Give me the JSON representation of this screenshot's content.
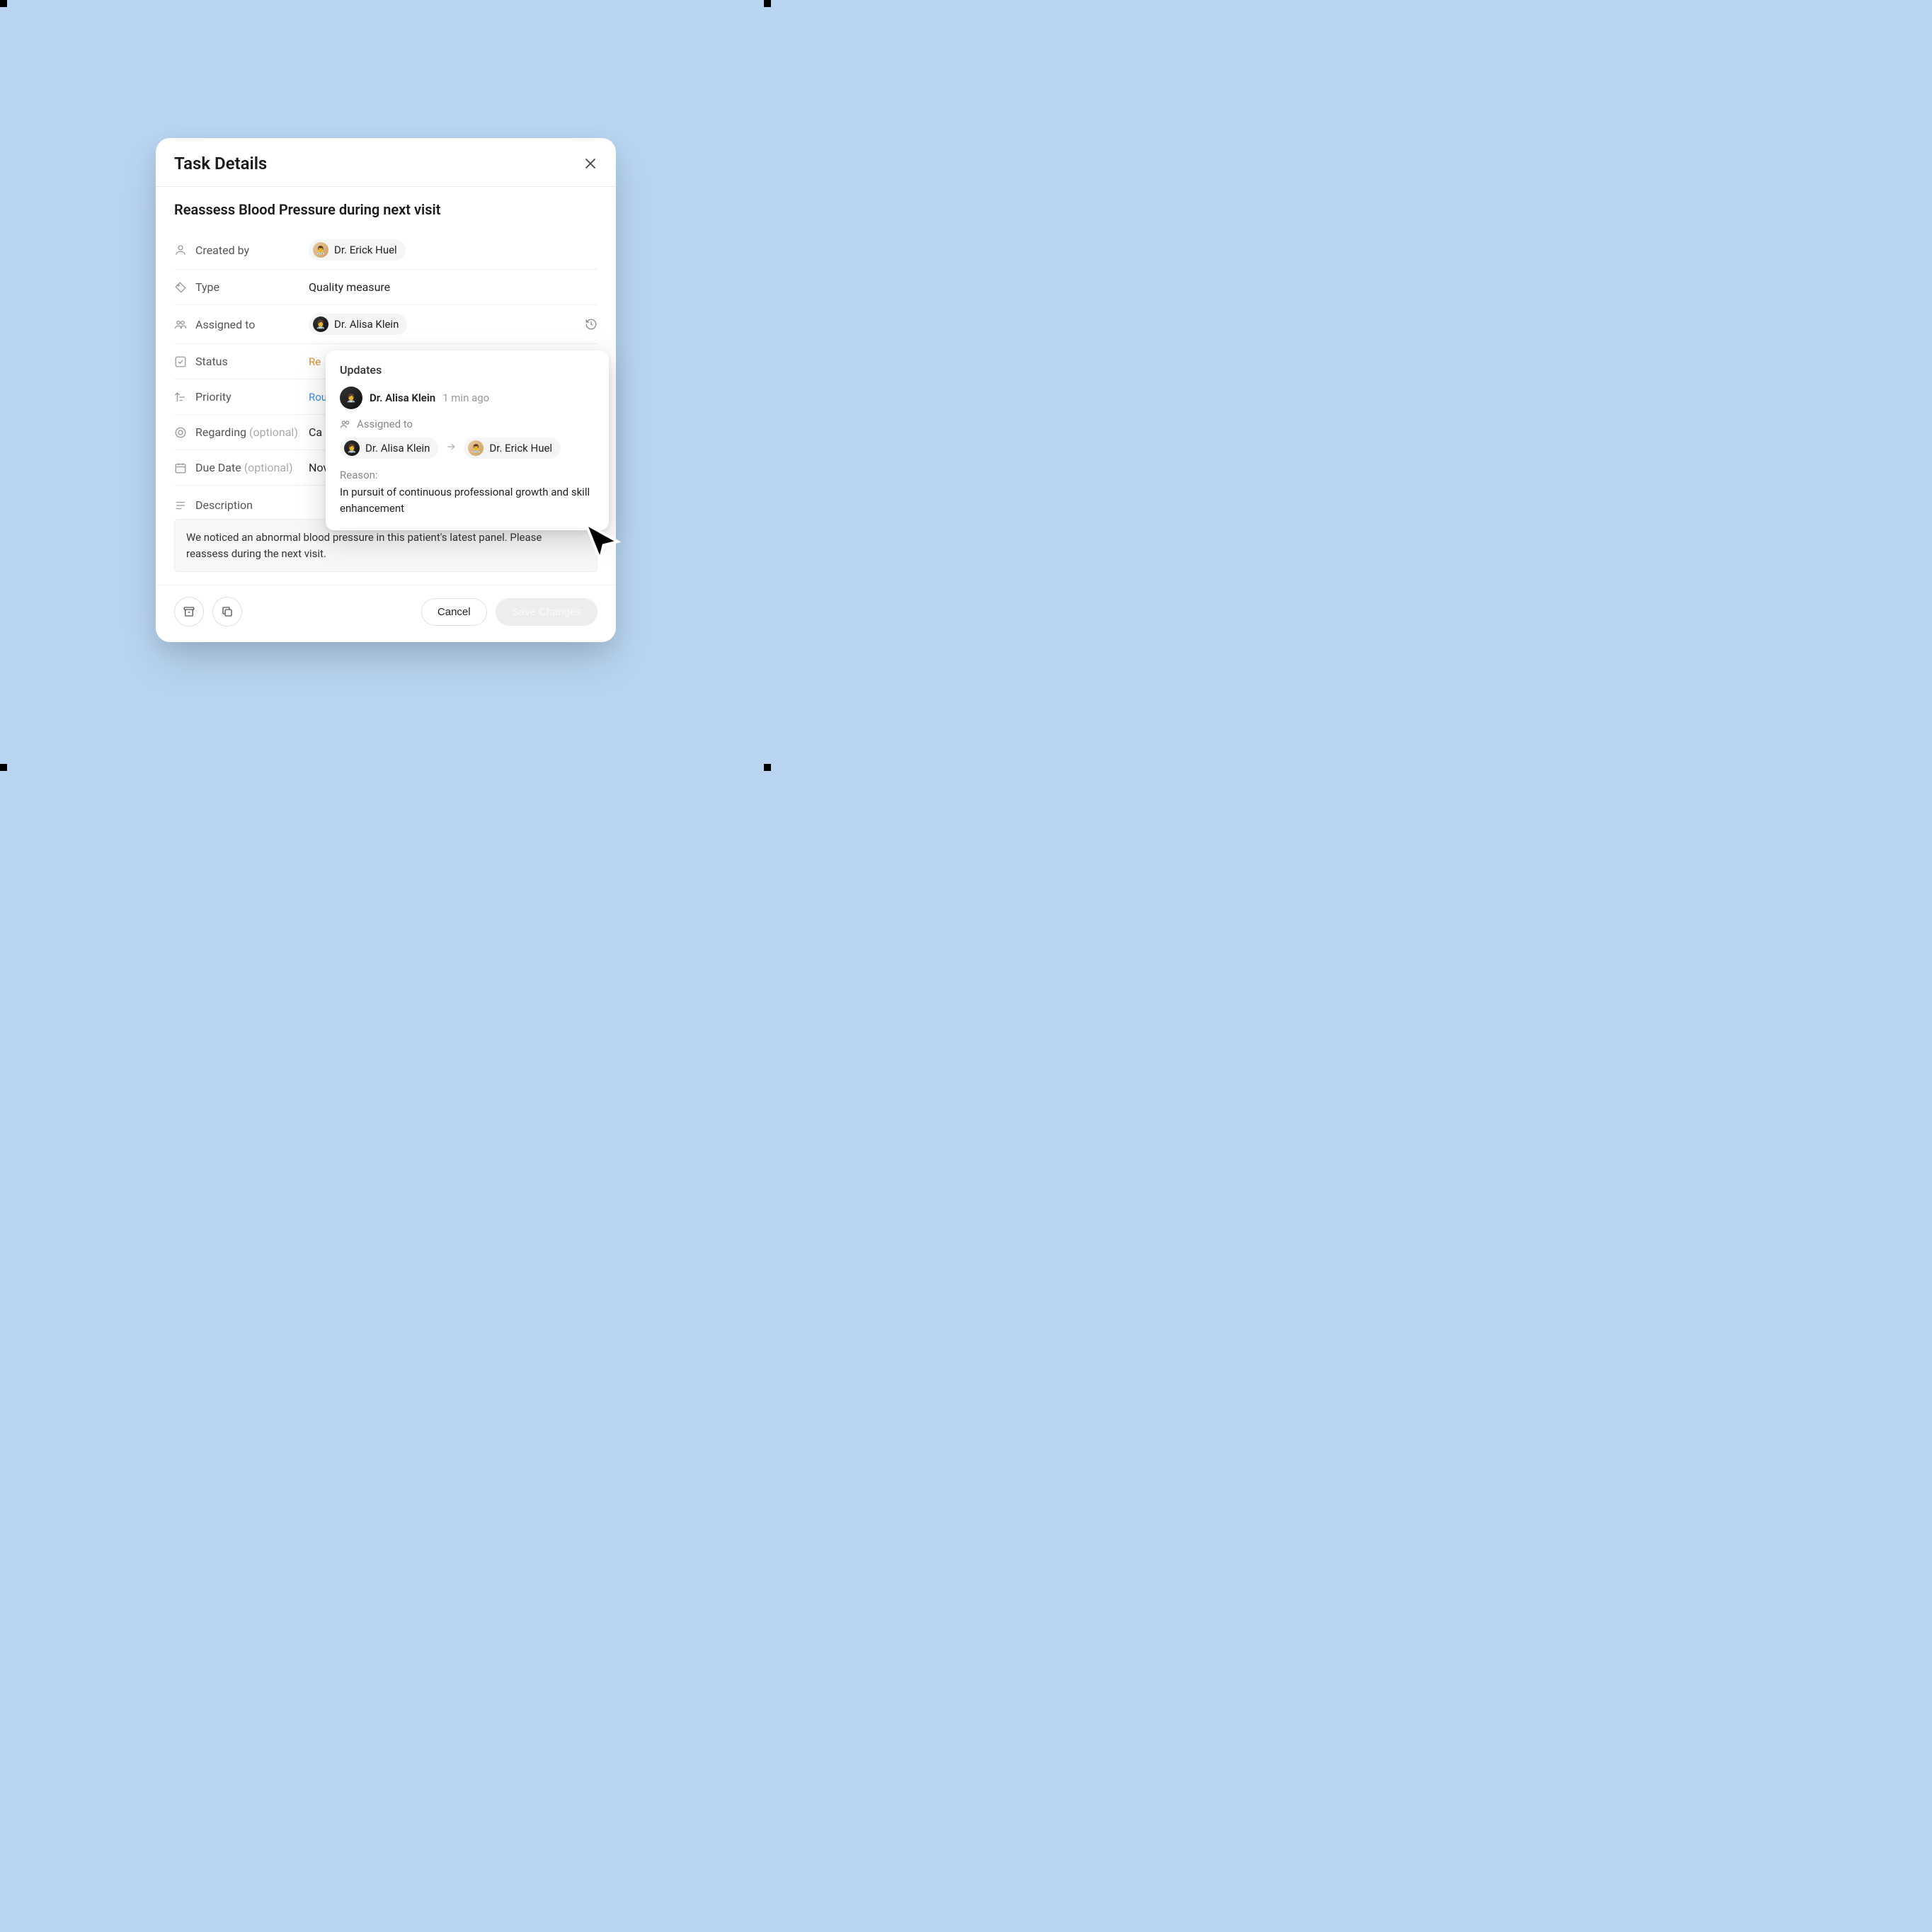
{
  "modal": {
    "title": "Task Details",
    "task_title": "Reassess Blood Pressure during next visit",
    "fields": {
      "created_by": {
        "label": "Created by",
        "value": "Dr. Erick Huel"
      },
      "type": {
        "label": "Type",
        "value": "Quality measure"
      },
      "assigned_to": {
        "label": "Assigned to",
        "value": "Dr. Alisa Klein"
      },
      "status": {
        "label": "Status",
        "value": "Re"
      },
      "priority": {
        "label": "Priority",
        "value": "Rou"
      },
      "regarding": {
        "label": "Regarding",
        "optional": "(optional)",
        "value": "Ca"
      },
      "due_date": {
        "label": "Due Date",
        "optional": "(optional)",
        "value": "Nov"
      },
      "description": {
        "label": "Description",
        "value": "We noticed an abnormal blood pressure in this patient's latest panel. Please reassess during the next visit."
      }
    },
    "buttons": {
      "cancel": "Cancel",
      "save": "Save Changes"
    }
  },
  "popover": {
    "title": "Updates",
    "actor": "Dr. Alisa Klein",
    "time": "1 min ago",
    "changed_label": "Assigned to",
    "from": "Dr. Alisa Klein",
    "to": "Dr. Erick Huel",
    "reason_label": "Reason:",
    "reason_text": "In pursuit of continuous professional growth and skill enhancement"
  }
}
